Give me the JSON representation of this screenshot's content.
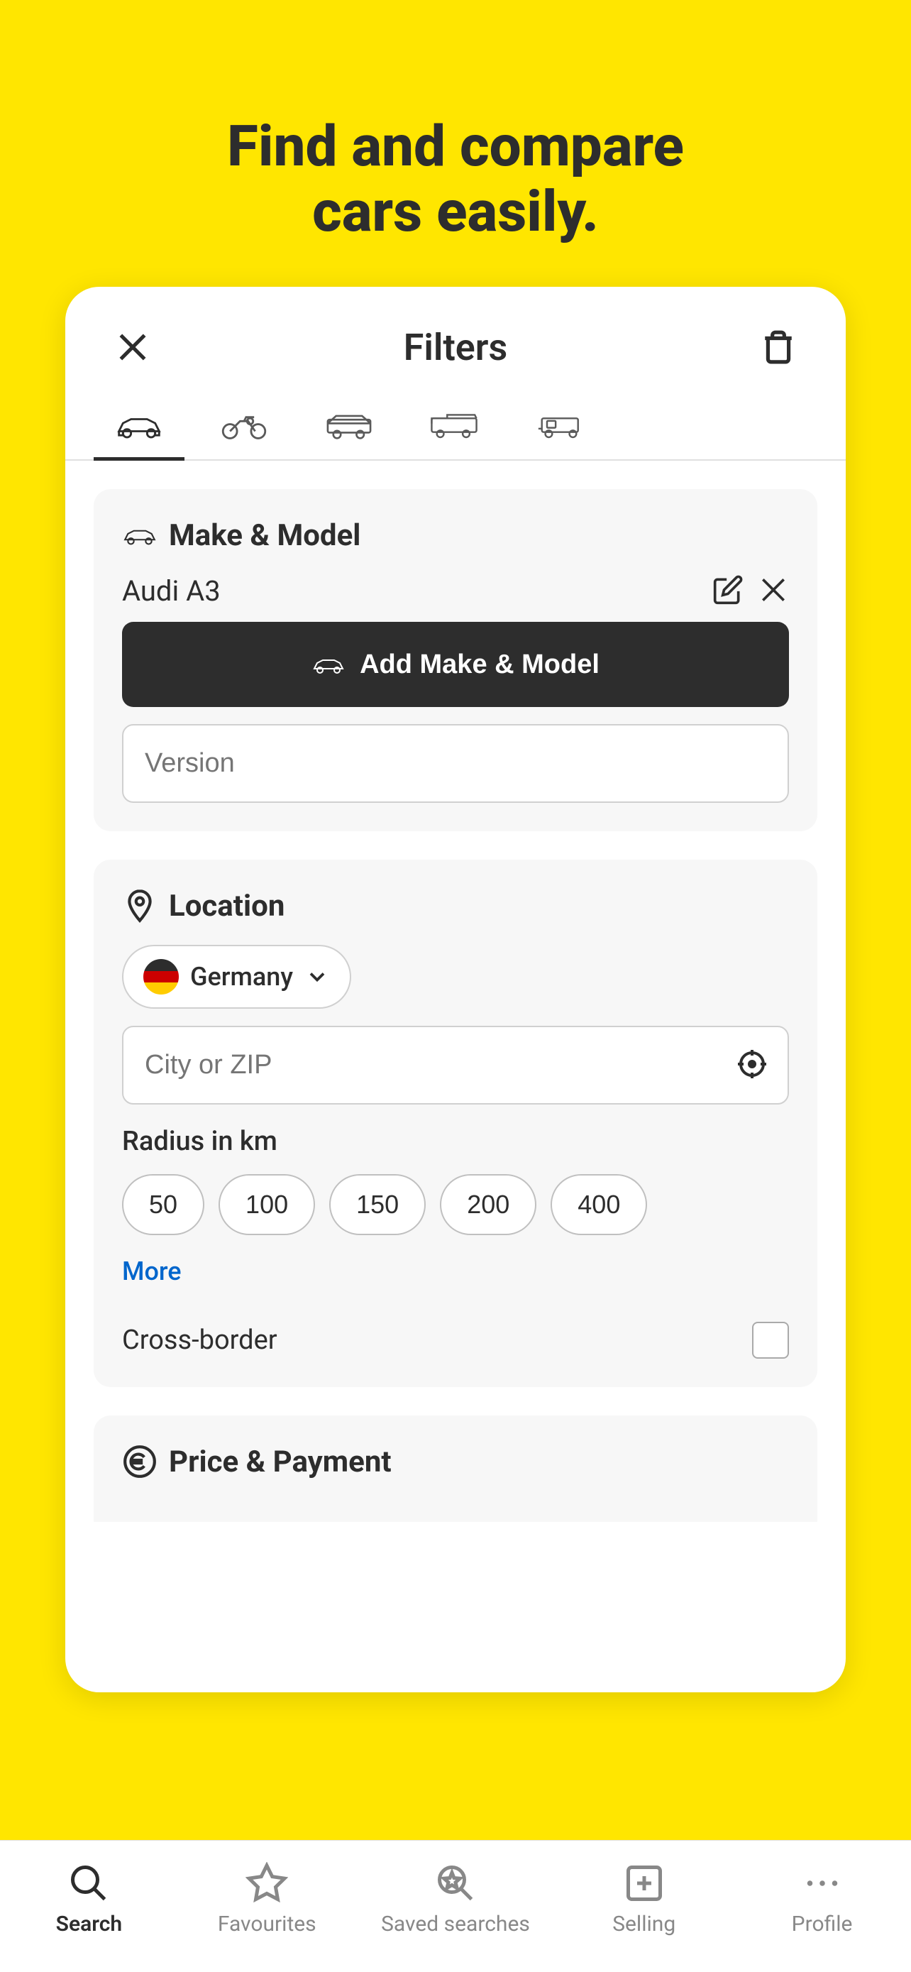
{
  "hero": {
    "line1": "Find and compare",
    "line2": "cars easily."
  },
  "filters": {
    "title": "Filters",
    "close_label": "close",
    "trash_label": "delete filters"
  },
  "vehicle_tabs": [
    {
      "id": "car",
      "label": "Car",
      "active": true
    },
    {
      "id": "motorcycle",
      "label": "Motorcycle",
      "active": false
    },
    {
      "id": "van",
      "label": "Van",
      "active": false
    },
    {
      "id": "truck",
      "label": "Truck",
      "active": false
    },
    {
      "id": "caravan",
      "label": "Caravan",
      "active": false
    }
  ],
  "make_model": {
    "section_title": "Make & Model",
    "selected_model": "Audi A3",
    "add_button_label": "Add Make & Model",
    "version_placeholder": "Version"
  },
  "location": {
    "section_title": "Location",
    "country": "Germany",
    "city_zip_placeholder": "City or ZIP",
    "radius_label": "Radius in km",
    "radius_options": [
      "50",
      "100",
      "150",
      "200",
      "400"
    ],
    "more_label": "More",
    "cross_border_label": "Cross-border"
  },
  "price_payment": {
    "section_title": "Price & Payment"
  },
  "bottom_nav": {
    "items": [
      {
        "id": "search",
        "label": "Search",
        "active": true
      },
      {
        "id": "favourites",
        "label": "Favourites",
        "active": false
      },
      {
        "id": "saved-searches",
        "label": "Saved searches",
        "active": false
      },
      {
        "id": "selling",
        "label": "Selling",
        "active": false
      },
      {
        "id": "profile",
        "label": "Profile",
        "active": false
      }
    ]
  }
}
